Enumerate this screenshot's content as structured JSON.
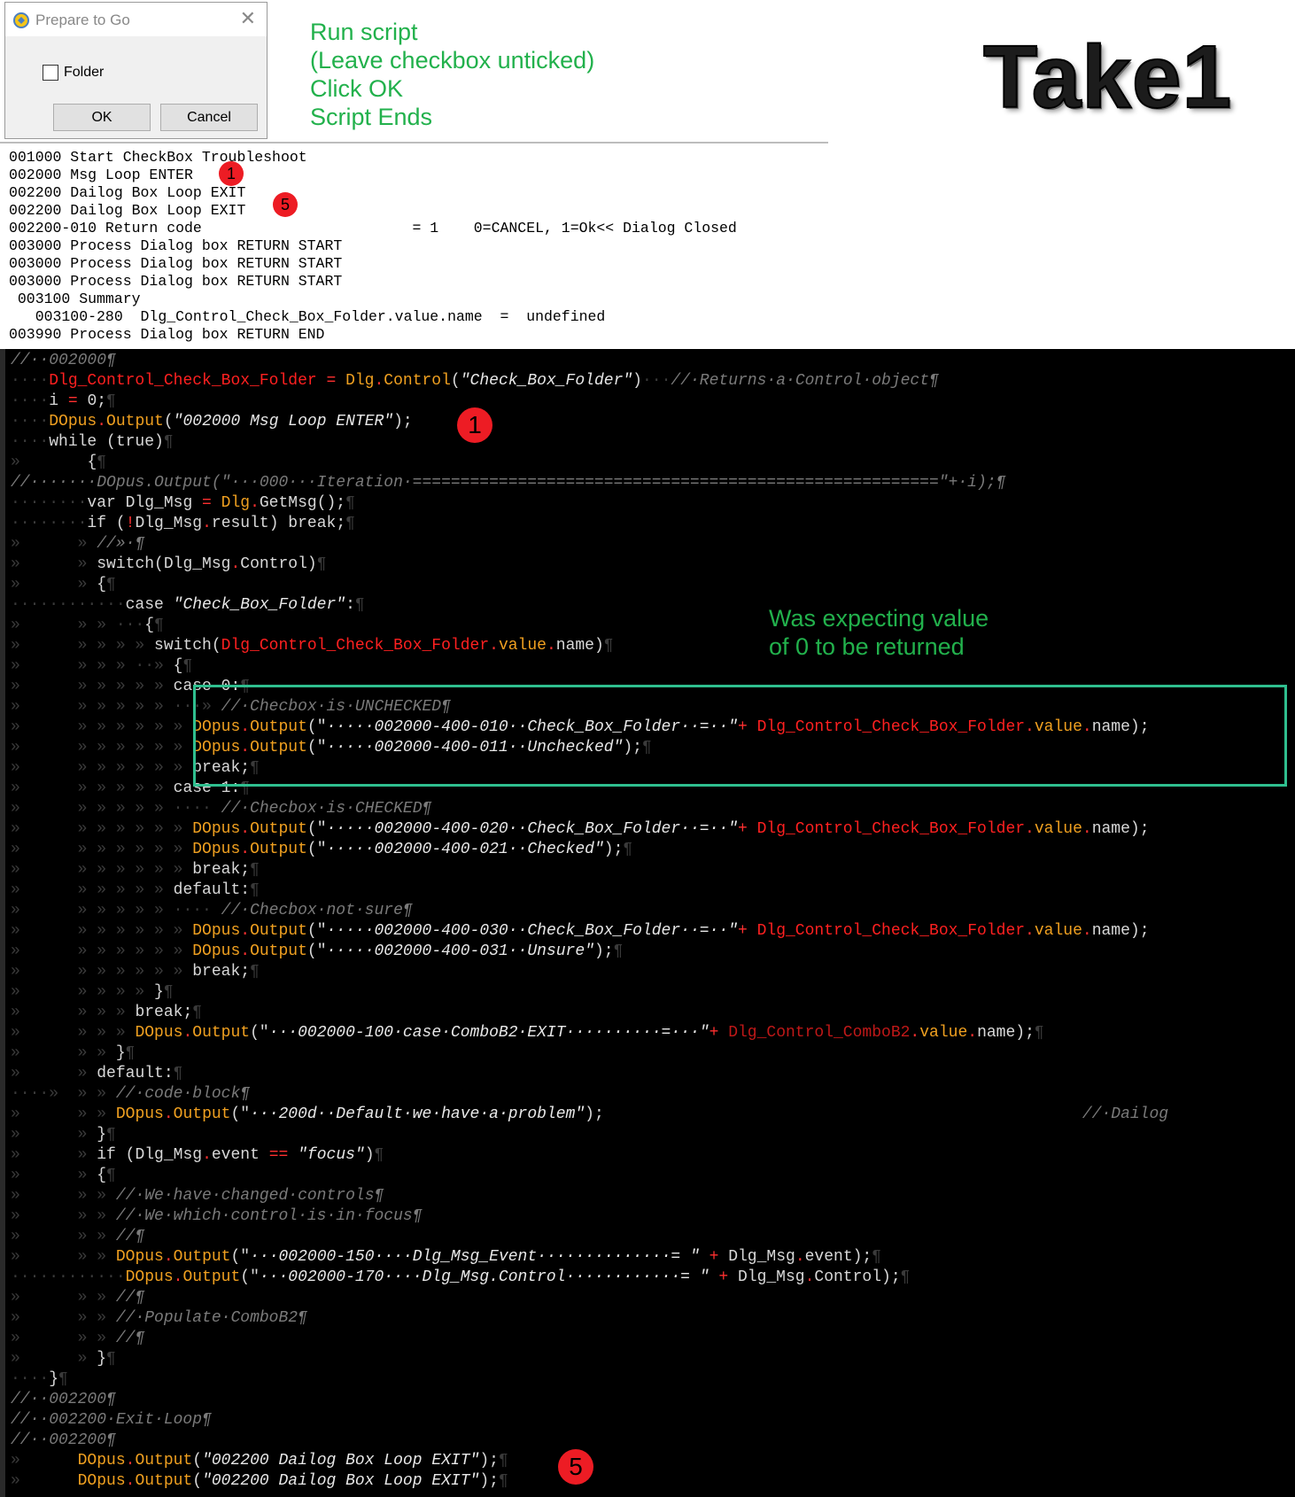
{
  "dialog": {
    "title": "Prepare to Go",
    "close": "✕",
    "checkbox_label": "Folder",
    "checkbox_checked": false,
    "ok": "OK",
    "cancel": "Cancel"
  },
  "instructions": [
    "Run script",
    "(Leave checkbox unticked)",
    "Click OK",
    "Script Ends"
  ],
  "take_title": "Take1",
  "log_lines": [
    "001000 Start CheckBox Troubleshoot",
    "002000 Msg Loop ENTER",
    "002200 Dailog Box Loop EXIT",
    "002200 Dailog Box Loop EXIT",
    "002200-010 Return code                        = 1    0=CANCEL, 1=Ok<< Dialog Closed",
    "003000 Process Dialog box RETURN START",
    "003000 Process Dialog box RETURN START",
    "003000 Process Dialog box RETURN START",
    " 003100 Summary",
    "   003100-280  Dlg_Control_Check_Box_Folder.value.name  =  undefined",
    "003990 Process Dialog box RETURN END"
  ],
  "badges": {
    "one": "1",
    "five": "5"
  },
  "annotation": [
    "Was expecting value",
    "of 0 to be returned"
  ],
  "code_lines": [
    [
      [
        "//··002000¶",
        "com"
      ]
    ],
    [
      [
        "····",
        "ws"
      ],
      [
        "Dlg_Control_Check_Box_Folder",
        "red"
      ],
      [
        " = ",
        "op"
      ],
      [
        "Dlg",
        "gold"
      ],
      [
        ".",
        "op"
      ],
      [
        "Control",
        "gold"
      ],
      [
        "(",
        "plain"
      ],
      [
        "\"Check_Box_Folder\"",
        "str"
      ],
      [
        ")",
        "plain"
      ],
      [
        "···",
        "ws"
      ],
      [
        "//·Returns·a·Control·object¶",
        "com"
      ]
    ],
    [
      [
        "····",
        "ws"
      ],
      [
        "i",
        "plain"
      ],
      [
        " = ",
        "op"
      ],
      [
        "0;",
        "plain"
      ],
      [
        "¶",
        "ws"
      ]
    ],
    [
      [
        "····",
        "ws"
      ],
      [
        "DOpus",
        "gold"
      ],
      [
        ".",
        "op"
      ],
      [
        "Output",
        "gold"
      ],
      [
        "(",
        "plain"
      ],
      [
        "\"002000 Msg Loop ENTER\"",
        "str"
      ],
      [
        ");",
        "plain"
      ]
    ],
    [
      [
        "····",
        "ws"
      ],
      [
        "while ",
        "plain"
      ],
      [
        "(true)",
        "plain"
      ],
      [
        "¶",
        "ws"
      ]
    ],
    [
      [
        "»",
        "ws"
      ],
      [
        "       ",
        "ws"
      ],
      [
        "{",
        "plain"
      ],
      [
        "¶",
        "ws"
      ]
    ],
    [
      [
        "//·······DOpus.Output(\"···000···Iteration·=======================================================\"+·i);¶",
        "com"
      ]
    ],
    [
      [
        "········",
        "ws"
      ],
      [
        "var Dlg_Msg",
        "plain"
      ],
      [
        " = ",
        "op"
      ],
      [
        "Dlg",
        "gold"
      ],
      [
        ".",
        "op"
      ],
      [
        "GetMsg",
        "plain"
      ],
      [
        "();",
        "plain"
      ],
      [
        "¶",
        "ws"
      ]
    ],
    [
      [
        "········",
        "ws"
      ],
      [
        "if ",
        "plain"
      ],
      [
        "(",
        "plain"
      ],
      [
        "!",
        "op"
      ],
      [
        "Dlg_Msg",
        "plain"
      ],
      [
        ".",
        "op"
      ],
      [
        "result) break;",
        "plain"
      ],
      [
        "¶",
        "ws"
      ]
    ],
    [
      [
        "»",
        "ws"
      ],
      [
        "      » ",
        "ws"
      ],
      [
        "//»·¶",
        "com"
      ]
    ],
    [
      [
        "»",
        "ws"
      ],
      [
        "      » ",
        "ws"
      ],
      [
        "switch",
        "plain"
      ],
      [
        "(Dlg_Msg",
        "plain"
      ],
      [
        ".",
        "op"
      ],
      [
        "Control)",
        "plain"
      ],
      [
        "¶",
        "ws"
      ]
    ],
    [
      [
        "»",
        "ws"
      ],
      [
        "      » ",
        "ws"
      ],
      [
        "{",
        "plain"
      ],
      [
        "¶",
        "ws"
      ]
    ],
    [
      [
        "············",
        "ws"
      ],
      [
        "case ",
        "plain"
      ],
      [
        "\"Check_Box_Folder\"",
        "str"
      ],
      [
        ":",
        "plain"
      ],
      [
        "¶",
        "ws"
      ]
    ],
    [
      [
        "»",
        "ws"
      ],
      [
        "      » » ···",
        "ws"
      ],
      [
        "{",
        "plain"
      ],
      [
        "¶",
        "ws"
      ]
    ],
    [
      [
        "»",
        "ws"
      ],
      [
        "      » » » » ",
        "ws"
      ],
      [
        "switch",
        "plain"
      ],
      [
        "(",
        "plain"
      ],
      [
        "Dlg_Control_Check_Box_Folder",
        "red"
      ],
      [
        ".",
        "op"
      ],
      [
        "value",
        "gold"
      ],
      [
        ".",
        "op"
      ],
      [
        "name)",
        "plain"
      ],
      [
        "¶",
        "ws"
      ]
    ],
    [
      [
        "»",
        "ws"
      ],
      [
        "      » » » ··» ",
        "ws"
      ],
      [
        "{",
        "plain"
      ],
      [
        "¶",
        "ws"
      ]
    ],
    [
      [
        "»",
        "ws"
      ],
      [
        "      » » » » » ",
        "ws"
      ],
      [
        "case 0:",
        "plain"
      ],
      [
        "¶",
        "ws"
      ]
    ],
    [
      [
        "»",
        "ws"
      ],
      [
        "      » » » » » ···» ",
        "ws"
      ],
      [
        "//·Checbox·is·UNCHECKED¶",
        "com"
      ]
    ],
    [
      [
        "»",
        "ws"
      ],
      [
        "      » » » » » » ",
        "ws"
      ],
      [
        "DOpus",
        "gold"
      ],
      [
        ".",
        "op"
      ],
      [
        "Output",
        "gold"
      ],
      [
        "(\"",
        "plain"
      ],
      [
        "·····002000-400-010··Check_Box_Folder··=··\"",
        "str"
      ],
      [
        "+ ",
        "op"
      ],
      [
        "Dlg_Control_Check_Box_Folder",
        "red"
      ],
      [
        ".",
        "op"
      ],
      [
        "value",
        "gold"
      ],
      [
        ".",
        "op"
      ],
      [
        "name);",
        "plain"
      ]
    ],
    [
      [
        "»",
        "ws"
      ],
      [
        "      » » » » » » ",
        "ws"
      ],
      [
        "DOpus",
        "gold"
      ],
      [
        ".",
        "op"
      ],
      [
        "Output",
        "gold"
      ],
      [
        "(\"",
        "plain"
      ],
      [
        "·····002000-400-011··Unchecked\"",
        "str"
      ],
      [
        ");",
        "plain"
      ],
      [
        "¶",
        "ws"
      ]
    ],
    [
      [
        "»",
        "ws"
      ],
      [
        "      » » » » » » ",
        "ws"
      ],
      [
        "break;",
        "plain"
      ],
      [
        "¶",
        "ws"
      ]
    ],
    [
      [
        "»",
        "ws"
      ],
      [
        "      » » » » » ",
        "ws"
      ],
      [
        "case 1:",
        "plain"
      ],
      [
        "¶",
        "ws"
      ]
    ],
    [
      [
        "»",
        "ws"
      ],
      [
        "      » » » » » ···· ",
        "ws"
      ],
      [
        "//·Checbox·is·CHECKED¶",
        "com"
      ]
    ],
    [
      [
        "»",
        "ws"
      ],
      [
        "      » » » » » » ",
        "ws"
      ],
      [
        "DOpus",
        "gold"
      ],
      [
        ".",
        "op"
      ],
      [
        "Output",
        "gold"
      ],
      [
        "(\"",
        "plain"
      ],
      [
        "·····002000-400-020··Check_Box_Folder··=··\"",
        "str"
      ],
      [
        "+ ",
        "op"
      ],
      [
        "Dlg_Control_Check_Box_Folder",
        "red"
      ],
      [
        ".",
        "op"
      ],
      [
        "value",
        "gold"
      ],
      [
        ".",
        "op"
      ],
      [
        "name);",
        "plain"
      ]
    ],
    [
      [
        "»",
        "ws"
      ],
      [
        "      » » » » » » ",
        "ws"
      ],
      [
        "DOpus",
        "gold"
      ],
      [
        ".",
        "op"
      ],
      [
        "Output",
        "gold"
      ],
      [
        "(\"",
        "plain"
      ],
      [
        "·····002000-400-021··Checked\"",
        "str"
      ],
      [
        ");",
        "plain"
      ],
      [
        "¶",
        "ws"
      ]
    ],
    [
      [
        "»",
        "ws"
      ],
      [
        "      » » » » » » ",
        "ws"
      ],
      [
        "break;",
        "plain"
      ],
      [
        "¶",
        "ws"
      ]
    ],
    [
      [
        "»",
        "ws"
      ],
      [
        "      » » » » » ",
        "ws"
      ],
      [
        "default:",
        "plain"
      ],
      [
        "¶",
        "ws"
      ]
    ],
    [
      [
        "»",
        "ws"
      ],
      [
        "      » » » » » ···· ",
        "ws"
      ],
      [
        "//·Checbox·not·sure¶",
        "com"
      ]
    ],
    [
      [
        "»",
        "ws"
      ],
      [
        "      » » » » » » ",
        "ws"
      ],
      [
        "DOpus",
        "gold"
      ],
      [
        ".",
        "op"
      ],
      [
        "Output",
        "gold"
      ],
      [
        "(\"",
        "plain"
      ],
      [
        "·····002000-400-030··Check_Box_Folder··=··\"",
        "str"
      ],
      [
        "+ ",
        "op"
      ],
      [
        "Dlg_Control_Check_Box_Folder",
        "red"
      ],
      [
        ".",
        "op"
      ],
      [
        "value",
        "gold"
      ],
      [
        ".",
        "op"
      ],
      [
        "name);",
        "plain"
      ]
    ],
    [
      [
        "»",
        "ws"
      ],
      [
        "      » » » » » » ",
        "ws"
      ],
      [
        "DOpus",
        "gold"
      ],
      [
        ".",
        "op"
      ],
      [
        "Output",
        "gold"
      ],
      [
        "(\"",
        "plain"
      ],
      [
        "·····002000-400-031··Unsure\"",
        "str"
      ],
      [
        ");",
        "plain"
      ],
      [
        "¶",
        "ws"
      ]
    ],
    [
      [
        "»",
        "ws"
      ],
      [
        "      » » » » » » ",
        "ws"
      ],
      [
        "break;",
        "plain"
      ],
      [
        "¶",
        "ws"
      ]
    ],
    [
      [
        "»",
        "ws"
      ],
      [
        "      » » » » ",
        "ws"
      ],
      [
        "}",
        "plain"
      ],
      [
        "¶",
        "ws"
      ]
    ],
    [
      [
        "»",
        "ws"
      ],
      [
        "      » » » ",
        "ws"
      ],
      [
        "break;",
        "plain"
      ],
      [
        "¶",
        "ws"
      ]
    ],
    [
      [
        "»",
        "ws"
      ],
      [
        "      » » » ",
        "ws"
      ],
      [
        "DOpus",
        "gold"
      ],
      [
        ".",
        "op"
      ],
      [
        "Output",
        "gold"
      ],
      [
        "(\"",
        "plain"
      ],
      [
        "···002000-100·case·ComboB2·EXIT··········=···\"",
        "str"
      ],
      [
        "+ ",
        "op"
      ],
      [
        "Dlg_Control_ComboB2",
        "redthin"
      ],
      [
        ".",
        "op"
      ],
      [
        "value",
        "gold"
      ],
      [
        ".",
        "op"
      ],
      [
        "name);",
        "plain"
      ],
      [
        "¶",
        "ws"
      ]
    ],
    [
      [
        "»",
        "ws"
      ],
      [
        "      » » ",
        "ws"
      ],
      [
        "}",
        "plain"
      ],
      [
        "¶",
        "ws"
      ]
    ],
    [
      [
        "»",
        "ws"
      ],
      [
        "      » ",
        "ws"
      ],
      [
        "default:",
        "plain"
      ],
      [
        "¶",
        "ws"
      ]
    ],
    [
      [
        "····»",
        "ws"
      ],
      [
        "  » » ",
        "ws"
      ],
      [
        "//·code·block¶",
        "com"
      ]
    ],
    [
      [
        "»",
        "ws"
      ],
      [
        "      » » ",
        "ws"
      ],
      [
        "DOpus",
        "gold"
      ],
      [
        ".",
        "op"
      ],
      [
        "Output",
        "gold"
      ],
      [
        "(\"",
        "plain"
      ],
      [
        "···200d··Default·we·have·a·problem\"",
        "str"
      ],
      [
        ");",
        "plain"
      ],
      [
        "                                                  ",
        "ws"
      ],
      [
        "//·Dailog",
        "com"
      ]
    ],
    [
      [
        "»",
        "ws"
      ],
      [
        "      » ",
        "ws"
      ],
      [
        "}",
        "plain"
      ],
      [
        "¶",
        "ws"
      ]
    ],
    [
      [
        "»",
        "ws"
      ],
      [
        "      » ",
        "ws"
      ],
      [
        "if ",
        "plain"
      ],
      [
        "(Dlg_Msg",
        "plain"
      ],
      [
        ".",
        "op"
      ],
      [
        "event ",
        "plain"
      ],
      [
        "==",
        "op"
      ],
      [
        " ",
        "plain"
      ],
      [
        "\"focus\"",
        "str"
      ],
      [
        ")",
        "plain"
      ],
      [
        "¶",
        "ws"
      ]
    ],
    [
      [
        "»",
        "ws"
      ],
      [
        "      » ",
        "ws"
      ],
      [
        "{",
        "plain"
      ],
      [
        "¶",
        "ws"
      ]
    ],
    [
      [
        "»",
        "ws"
      ],
      [
        "      » » ",
        "ws"
      ],
      [
        "//·We·have·changed·controls¶",
        "com"
      ]
    ],
    [
      [
        "»",
        "ws"
      ],
      [
        "      » » ",
        "ws"
      ],
      [
        "//·We·which·control·is·in·focus¶",
        "com"
      ]
    ],
    [
      [
        "»",
        "ws"
      ],
      [
        "      » » ",
        "ws"
      ],
      [
        "//¶",
        "com"
      ]
    ],
    [
      [
        "»",
        "ws"
      ],
      [
        "      » » ",
        "ws"
      ],
      [
        "DOpus",
        "gold"
      ],
      [
        ".",
        "op"
      ],
      [
        "Output",
        "gold"
      ],
      [
        "(\"",
        "plain"
      ],
      [
        "···002000-150····Dlg_Msg_Event··············= \"",
        "str"
      ],
      [
        " + ",
        "op"
      ],
      [
        "Dlg_Msg",
        "plain"
      ],
      [
        ".",
        "op"
      ],
      [
        "event);",
        "plain"
      ],
      [
        "¶",
        "ws"
      ]
    ],
    [
      [
        "············",
        "ws"
      ],
      [
        "DOpus",
        "gold"
      ],
      [
        ".",
        "op"
      ],
      [
        "Output",
        "gold"
      ],
      [
        "(\"",
        "plain"
      ],
      [
        "···002000-170····Dlg_Msg.Control············= \"",
        "str"
      ],
      [
        " + ",
        "op"
      ],
      [
        "Dlg_Msg",
        "plain"
      ],
      [
        ".",
        "op"
      ],
      [
        "Control);",
        "plain"
      ],
      [
        "¶",
        "ws"
      ]
    ],
    [
      [
        "»",
        "ws"
      ],
      [
        "      » » ",
        "ws"
      ],
      [
        "//¶",
        "com"
      ]
    ],
    [
      [
        "»",
        "ws"
      ],
      [
        "      » » ",
        "ws"
      ],
      [
        "//·Populate·ComboB2¶",
        "com"
      ]
    ],
    [
      [
        "»",
        "ws"
      ],
      [
        "      » » ",
        "ws"
      ],
      [
        "//¶",
        "com"
      ]
    ],
    [
      [
        "»",
        "ws"
      ],
      [
        "      » ",
        "ws"
      ],
      [
        "}",
        "plain"
      ],
      [
        "¶",
        "ws"
      ]
    ],
    [
      [
        "····",
        "ws"
      ],
      [
        "}",
        "plain"
      ],
      [
        "¶",
        "ws"
      ]
    ],
    [
      [
        "//··002200¶",
        "com"
      ]
    ],
    [
      [
        "//··002200·Exit·Loop¶",
        "com"
      ]
    ],
    [
      [
        "//··002200¶",
        "com"
      ]
    ],
    [
      [
        "»",
        "ws"
      ],
      [
        "      ",
        "ws"
      ],
      [
        "DOpus",
        "gold"
      ],
      [
        ".",
        "op"
      ],
      [
        "Output",
        "gold"
      ],
      [
        "(",
        "plain"
      ],
      [
        "\"002200 Dailog Box Loop EXIT\"",
        "str"
      ],
      [
        ");",
        "plain"
      ],
      [
        "¶",
        "ws"
      ]
    ],
    [
      [
        "»",
        "ws"
      ],
      [
        "      ",
        "ws"
      ],
      [
        "DOpus",
        "gold"
      ],
      [
        ".",
        "op"
      ],
      [
        "Output",
        "gold"
      ],
      [
        "(",
        "plain"
      ],
      [
        "\"002200 Dailog Box Loop EXIT\"",
        "str"
      ],
      [
        ");",
        "plain"
      ],
      [
        "¶",
        "ws"
      ]
    ]
  ]
}
